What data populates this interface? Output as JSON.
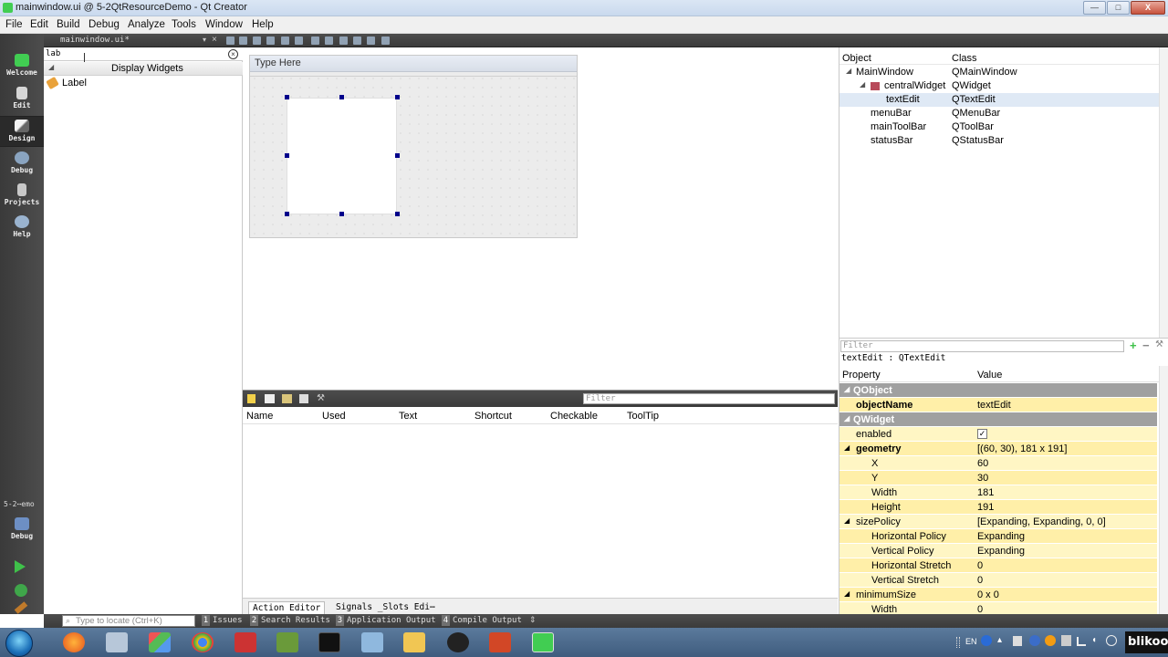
{
  "window": {
    "title": "mainwindow.ui @ 5-2QtResourceDemo - Qt Creator",
    "controls": [
      "—",
      "□",
      "X"
    ]
  },
  "menu": [
    "File",
    "Edit",
    "Build",
    "Debug",
    "Analyze",
    "Tools",
    "Window",
    "Help"
  ],
  "modes": [
    {
      "label": "Welcome",
      "icon": "qt-logo-icon"
    },
    {
      "label": "Edit",
      "icon": "edit-document-icon"
    },
    {
      "label": "Design",
      "icon": "design-pen-icon"
    },
    {
      "label": "Debug",
      "icon": "debug-bug-icon"
    },
    {
      "label": "Projects",
      "icon": "projects-icon"
    },
    {
      "label": "Help",
      "icon": "help-icon"
    }
  ],
  "target": {
    "project": "5-2⋯emo",
    "label": "Debug"
  },
  "editor_tab": "mainwindow.ui*",
  "widget_box": {
    "filter_value": "lab",
    "category": "Display Widgets",
    "item": "Label"
  },
  "form": {
    "menu_placeholder": "Type Here"
  },
  "action_editor": {
    "filter_placeholder": "Filter",
    "columns": [
      "Name",
      "Used",
      "Text",
      "Shortcut",
      "Checkable",
      "ToolTip"
    ],
    "tabs": [
      "Action Editor",
      "Signals _Slots Edi⋯"
    ]
  },
  "object_inspector": {
    "columns": [
      "Object",
      "Class"
    ],
    "rows": [
      {
        "object": "MainWindow",
        "class": "QMainWindow"
      },
      {
        "object": "centralWidget",
        "class": "QWidget"
      },
      {
        "object": "textEdit",
        "class": "QTextEdit"
      },
      {
        "object": "menuBar",
        "class": "QMenuBar"
      },
      {
        "object": "mainToolBar",
        "class": "QToolBar"
      },
      {
        "object": "statusBar",
        "class": "QStatusBar"
      }
    ]
  },
  "property_editor": {
    "filter_placeholder": "Filter",
    "object_label": "textEdit : QTextEdit",
    "columns": [
      "Property",
      "Value"
    ],
    "rows": [
      {
        "name": "QObject",
        "value": ""
      },
      {
        "name": "objectName",
        "value": "textEdit"
      },
      {
        "name": "QWidget",
        "value": ""
      },
      {
        "name": "enabled",
        "value": "✓"
      },
      {
        "name": "geometry",
        "value": "[(60, 30), 181 x 191]"
      },
      {
        "name": "X",
        "value": "60"
      },
      {
        "name": "Y",
        "value": "30"
      },
      {
        "name": "Width",
        "value": "181"
      },
      {
        "name": "Height",
        "value": "191"
      },
      {
        "name": "sizePolicy",
        "value": "[Expanding, Expanding, 0, 0]"
      },
      {
        "name": "Horizontal Policy",
        "value": "Expanding"
      },
      {
        "name": "Vertical Policy",
        "value": "Expanding"
      },
      {
        "name": "Horizontal Stretch",
        "value": "0"
      },
      {
        "name": "Vertical Stretch",
        "value": "0"
      },
      {
        "name": "minimumSize",
        "value": "0 x 0"
      },
      {
        "name": "Width",
        "value": "0"
      }
    ]
  },
  "output_bar": {
    "locator_placeholder": "Type to locate (Ctrl+K)",
    "buttons": [
      {
        "num": "1",
        "label": "Issues"
      },
      {
        "num": "2",
        "label": "Search Results"
      },
      {
        "num": "3",
        "label": "Application Output"
      },
      {
        "num": "4",
        "label": "Compile Output"
      }
    ]
  },
  "tray": {
    "lang": "EN",
    "brand": "blikoon"
  }
}
